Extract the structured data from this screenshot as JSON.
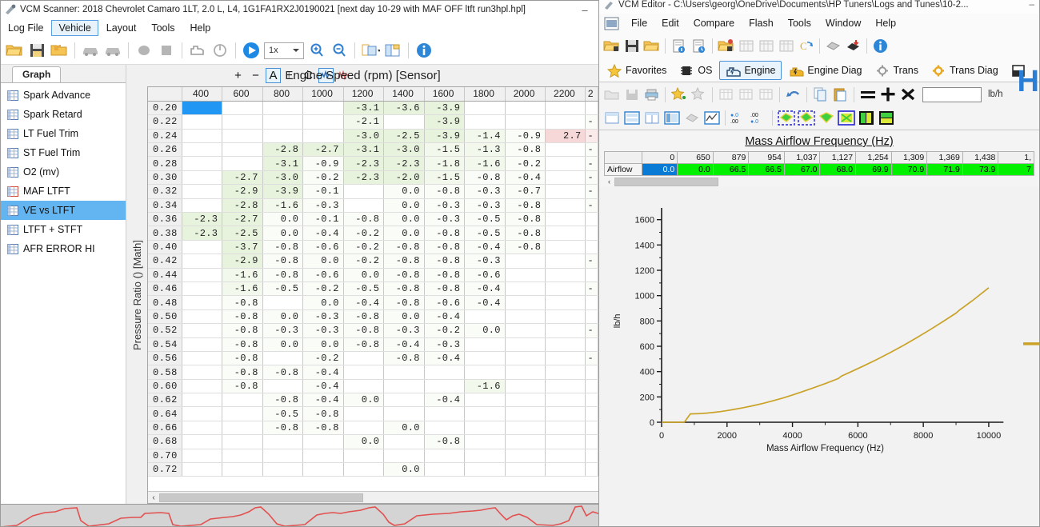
{
  "scanner": {
    "title": "VCM Scanner: 2018 Chevrolet Camaro 1LT, 2.0 L, L4, 1G1FA1RX2J0190021 [next day 10-29 with MAF OFF ltft run3hpl.hpl]",
    "minimize_label": "–",
    "menus": [
      {
        "label": "Log File",
        "active": false
      },
      {
        "label": "Vehicle",
        "active": true
      },
      {
        "label": "Layout",
        "active": false
      },
      {
        "label": "Tools",
        "active": false
      },
      {
        "label": "Help",
        "active": false
      }
    ],
    "toolbar": {
      "playback_speed": "1x",
      "icons": [
        "open-folder-icon",
        "save-icon",
        "open-recent-icon",
        "vehicle-icon",
        "vehicle-alt-icon",
        "record-icon",
        "stop-icon",
        "engine-icon",
        "power-icon",
        "play-icon",
        "zoom-in-icon",
        "zoom-out-icon",
        "layout-icon",
        "save-layout-icon",
        "info-icon"
      ]
    },
    "tab_label": "Graph",
    "sidebar_items": [
      {
        "label": "Spark Advance",
        "selected": false
      },
      {
        "label": "Spark Retard",
        "selected": false
      },
      {
        "label": "LT Fuel Trim",
        "selected": false
      },
      {
        "label": "ST Fuel Trim",
        "selected": false
      },
      {
        "label": "O2 (mv)",
        "selected": false
      },
      {
        "label": "MAF LTFT",
        "selected": false
      },
      {
        "label": "VE vs LTFT",
        "selected": true
      },
      {
        "label": "LTFT + STFT",
        "selected": false
      },
      {
        "label": "AFR ERROR HI",
        "selected": false
      }
    ],
    "grid_toolbar": {
      "plus": "+",
      "minus": "−",
      "a": "A",
      "l": "L",
      "c": "C",
      "graph1": "graph-icon",
      "graph2": "graph-alt-icon"
    },
    "grid": {
      "title": "Engine Speed (rpm) [Sensor]",
      "y_axis_label": "Pressure Ratio () [Math]",
      "corner": "",
      "columns": [
        "400",
        "600",
        "800",
        "1000",
        "1200",
        "1400",
        "1600",
        "1800",
        "2000",
        "2200",
        "2"
      ],
      "rows": [
        {
          "h": "0.20",
          "c": [
            "",
            "",
            "",
            "",
            "-3.1",
            "-3.6",
            "-3.9",
            "",
            "",
            "",
            ""
          ],
          "s": [
            "sel",
            "",
            "",
            "",
            "g1",
            "g1",
            "g1",
            "",
            "",
            "",
            ""
          ]
        },
        {
          "h": "0.22",
          "c": [
            "",
            "",
            "",
            "",
            "-2.1",
            "",
            "-3.9",
            "",
            "",
            "",
            "-"
          ],
          "s": [
            "",
            "",
            "",
            "",
            "g2",
            "",
            "g1",
            "",
            "",
            "",
            "g3"
          ]
        },
        {
          "h": "0.24",
          "c": [
            "",
            "",
            "",
            "",
            "-3.0",
            "-2.5",
            "-3.9",
            "-1.4",
            "-0.9",
            "2.7",
            "-"
          ],
          "s": [
            "",
            "",
            "",
            "",
            "g1",
            "g1",
            "g1",
            "g2",
            "g3",
            "r1",
            "r2"
          ]
        },
        {
          "h": "0.26",
          "c": [
            "",
            "",
            "-2.8",
            "-2.7",
            "-3.1",
            "-3.0",
            "-1.5",
            "-1.3",
            "-0.8",
            "",
            "-"
          ],
          "s": [
            "",
            "",
            "g1",
            "g1",
            "g1",
            "g1",
            "g2",
            "g2",
            "g3",
            "",
            "g3"
          ]
        },
        {
          "h": "0.28",
          "c": [
            "",
            "",
            "-3.1",
            "-0.9",
            "-2.3",
            "-2.3",
            "-1.8",
            "-1.6",
            "-0.2",
            "",
            "-"
          ],
          "s": [
            "",
            "",
            "g1",
            "g3",
            "g1",
            "g1",
            "g2",
            "g2",
            "g3",
            "",
            "g3"
          ]
        },
        {
          "h": "0.30",
          "c": [
            "",
            "-2.7",
            "-3.0",
            "-0.2",
            "-2.3",
            "-2.0",
            "-1.5",
            "-0.8",
            "-0.4",
            "",
            "-"
          ],
          "s": [
            "",
            "g1",
            "g1",
            "g3",
            "g1",
            "g1",
            "g2",
            "g3",
            "g3",
            "",
            "g3"
          ]
        },
        {
          "h": "0.32",
          "c": [
            "",
            "-2.9",
            "-3.9",
            "-0.1",
            "",
            "0.0",
            "-0.8",
            "-0.3",
            "-0.7",
            "",
            "-"
          ],
          "s": [
            "",
            "g1",
            "g1",
            "g3",
            "",
            "g3",
            "g3",
            "g3",
            "g3",
            "",
            "g3"
          ]
        },
        {
          "h": "0.34",
          "c": [
            "",
            "-2.8",
            "-1.6",
            "-0.3",
            "",
            "0.0",
            "-0.3",
            "-0.3",
            "-0.8",
            "",
            "-"
          ],
          "s": [
            "",
            "g1",
            "g2",
            "g3",
            "",
            "g3",
            "g3",
            "g3",
            "g3",
            "",
            "g3"
          ]
        },
        {
          "h": "0.36",
          "c": [
            "-2.3",
            "-2.7",
            "0.0",
            "-0.1",
            "-0.8",
            "0.0",
            "-0.3",
            "-0.5",
            "-0.8",
            "",
            ""
          ],
          "s": [
            "g1",
            "g1",
            "g3",
            "g3",
            "g3",
            "g3",
            "g3",
            "g3",
            "g3",
            "",
            ""
          ]
        },
        {
          "h": "0.38",
          "c": [
            "-2.3",
            "-2.5",
            "0.0",
            "-0.4",
            "-0.2",
            "0.0",
            "-0.8",
            "-0.5",
            "-0.8",
            "",
            ""
          ],
          "s": [
            "g1",
            "g1",
            "g3",
            "g3",
            "g3",
            "g3",
            "g3",
            "g3",
            "g3",
            "",
            ""
          ]
        },
        {
          "h": "0.40",
          "c": [
            "",
            "-3.7",
            "-0.8",
            "-0.6",
            "-0.2",
            "-0.8",
            "-0.8",
            "-0.4",
            "-0.8",
            "",
            ""
          ],
          "s": [
            "",
            "g1",
            "g3",
            "g3",
            "g3",
            "g3",
            "g3",
            "g3",
            "g3",
            "",
            ""
          ]
        },
        {
          "h": "0.42",
          "c": [
            "",
            "-2.9",
            "-0.8",
            "0.0",
            "-0.2",
            "-0.8",
            "-0.8",
            "-0.3",
            "",
            "",
            "-"
          ],
          "s": [
            "",
            "g1",
            "g3",
            "g3",
            "g3",
            "g3",
            "g3",
            "g3",
            "",
            "",
            "g3"
          ]
        },
        {
          "h": "0.44",
          "c": [
            "",
            "-1.6",
            "-0.8",
            "-0.6",
            "0.0",
            "-0.8",
            "-0.8",
            "-0.6",
            "",
            "",
            ""
          ],
          "s": [
            "",
            "g2",
            "g3",
            "g3",
            "g3",
            "g3",
            "g3",
            "g3",
            "",
            "",
            ""
          ]
        },
        {
          "h": "0.46",
          "c": [
            "",
            "-1.6",
            "-0.5",
            "-0.2",
            "-0.5",
            "-0.8",
            "-0.8",
            "-0.4",
            "",
            "",
            "-"
          ],
          "s": [
            "",
            "g2",
            "g3",
            "g3",
            "g3",
            "g3",
            "g3",
            "g3",
            "",
            "",
            "g3"
          ]
        },
        {
          "h": "0.48",
          "c": [
            "",
            "-0.8",
            "",
            "0.0",
            "-0.4",
            "-0.8",
            "-0.6",
            "-0.4",
            "",
            "",
            ""
          ],
          "s": [
            "",
            "g3",
            "",
            "g3",
            "g3",
            "g3",
            "g3",
            "g3",
            "",
            "",
            ""
          ]
        },
        {
          "h": "0.50",
          "c": [
            "",
            "-0.8",
            "0.0",
            "-0.3",
            "-0.8",
            "0.0",
            "-0.4",
            "",
            "",
            "",
            ""
          ],
          "s": [
            "",
            "g3",
            "g3",
            "g3",
            "g3",
            "g3",
            "g3",
            "",
            "",
            "",
            ""
          ]
        },
        {
          "h": "0.52",
          "c": [
            "",
            "-0.8",
            "-0.3",
            "-0.3",
            "-0.8",
            "-0.3",
            "-0.2",
            "0.0",
            "",
            "",
            "-"
          ],
          "s": [
            "",
            "g3",
            "g3",
            "g3",
            "g3",
            "g3",
            "g3",
            "g3",
            "",
            "",
            "g3"
          ]
        },
        {
          "h": "0.54",
          "c": [
            "",
            "-0.8",
            "0.0",
            "0.0",
            "-0.8",
            "-0.4",
            "-0.3",
            "",
            "",
            "",
            ""
          ],
          "s": [
            "",
            "g3",
            "g3",
            "g3",
            "g3",
            "g3",
            "g3",
            "",
            "",
            "",
            ""
          ]
        },
        {
          "h": "0.56",
          "c": [
            "",
            "-0.8",
            "",
            "-0.2",
            "",
            "-0.8",
            "-0.4",
            "",
            "",
            "",
            "-"
          ],
          "s": [
            "",
            "g3",
            "",
            "g3",
            "",
            "g3",
            "g3",
            "",
            "",
            "",
            "g3"
          ]
        },
        {
          "h": "0.58",
          "c": [
            "",
            "-0.8",
            "-0.8",
            "-0.4",
            "",
            "",
            "",
            "",
            "",
            "",
            ""
          ],
          "s": [
            "",
            "g3",
            "g3",
            "g3",
            "",
            "",
            "",
            "",
            "",
            "",
            ""
          ]
        },
        {
          "h": "0.60",
          "c": [
            "",
            "-0.8",
            "",
            "-0.4",
            "",
            "",
            "",
            "-1.6",
            "",
            "",
            ""
          ],
          "s": [
            "",
            "g3",
            "",
            "g3",
            "",
            "",
            "",
            "g2",
            "",
            "",
            ""
          ]
        },
        {
          "h": "0.62",
          "c": [
            "",
            "",
            "-0.8",
            "-0.4",
            "0.0",
            "",
            "-0.4",
            "",
            "",
            "",
            ""
          ],
          "s": [
            "",
            "",
            "g3",
            "g3",
            "g3",
            "",
            "g3",
            "",
            "",
            "",
            ""
          ]
        },
        {
          "h": "0.64",
          "c": [
            "",
            "",
            "-0.5",
            "-0.8",
            "",
            "",
            "",
            "",
            "",
            "",
            ""
          ],
          "s": [
            "",
            "",
            "g3",
            "g3",
            "",
            "",
            "",
            "",
            "",
            "",
            ""
          ]
        },
        {
          "h": "0.66",
          "c": [
            "",
            "",
            "-0.8",
            "-0.8",
            "",
            "0.0",
            "",
            "",
            "",
            "",
            ""
          ],
          "s": [
            "",
            "",
            "g3",
            "g3",
            "",
            "g3",
            "",
            "",
            "",
            "",
            ""
          ]
        },
        {
          "h": "0.68",
          "c": [
            "",
            "",
            "",
            "",
            "0.0",
            "",
            "-0.8",
            "",
            "",
            "",
            ""
          ],
          "s": [
            "",
            "",
            "",
            "",
            "g3",
            "",
            "g3",
            "",
            "",
            "",
            ""
          ]
        },
        {
          "h": "0.70",
          "c": [
            "",
            "",
            "",
            "",
            "",
            "",
            "",
            "",
            "",
            "",
            ""
          ],
          "s": [
            "",
            "",
            "",
            "",
            "",
            "",
            "",
            "",
            "",
            "",
            ""
          ]
        },
        {
          "h": "0.72",
          "c": [
            "",
            "",
            "",
            "",
            "",
            "0.0",
            "",
            "",
            "",
            "",
            ""
          ],
          "s": [
            "",
            "",
            "",
            "",
            "",
            "g3",
            "",
            "",
            "",
            "",
            ""
          ]
        }
      ]
    },
    "hscroll_arrow": "‹"
  },
  "editor": {
    "title": "VCM Editor - C:\\Users\\georg\\OneDrive\\Documents\\HP Tuners\\Logs and Tunes\\10-2...",
    "minimize_label": "–",
    "menus": [
      "File",
      "Edit",
      "Compare",
      "Flash",
      "Tools",
      "Window",
      "Help"
    ],
    "toolbar1_icons": [
      "open-icon",
      "save-icon",
      "open-folder-icon",
      "file-info-icon",
      "file-history-icon",
      "new-tune-icon",
      "table-icon-1",
      "table-icon-2",
      "table-icon-3",
      "compare-icon",
      "flash-read-icon",
      "flash-write-icon",
      "info-icon"
    ],
    "tabs": [
      {
        "label": "Favorites",
        "icon": "star-icon",
        "active": false
      },
      {
        "label": "OS",
        "icon": "chip-icon",
        "active": false
      },
      {
        "label": "Engine",
        "icon": "engine-icon",
        "active": true
      },
      {
        "label": "Engine Diag",
        "icon": "engine-diag-icon",
        "active": false
      },
      {
        "label": "Trans",
        "icon": "gear-icon",
        "active": false
      },
      {
        "label": "Trans Diag",
        "icon": "gear-diag-icon",
        "active": false
      }
    ],
    "toolbar2": {
      "icons": [
        "open-icon",
        "save-icon",
        "print-icon",
        "add-favorite-icon",
        "remove-favorite-icon",
        "table-icon-1",
        "table-icon-2",
        "table-icon-3",
        "undo-icon",
        "copy-icon",
        "paste-icon",
        "equals-icon",
        "plus-icon",
        "multiply-icon"
      ],
      "value_input": "",
      "unit": "lb/h"
    },
    "toolbar3_icons": [
      "view-single-icon",
      "view-split-h-icon",
      "view-split-v-icon",
      "view-table-icon",
      "diamond-icon",
      "graph-icon",
      "decimals-down-icon",
      "decimals-up-icon",
      "interp-left-icon",
      "interp-right-icon",
      "interp-both-icon",
      "interp-all-icon",
      "interp-vert-icon",
      "interp-horiz-icon"
    ],
    "maf_table": {
      "title": "Mass Airflow Frequency (Hz)",
      "row_label": "Airflow",
      "columns": [
        "0",
        "650",
        "879",
        "954",
        "1,037",
        "1,127",
        "1,254",
        "1,309",
        "1,369",
        "1,438",
        "1,"
      ],
      "values": [
        "0.0",
        "0.0",
        "66.5",
        "66.5",
        "67.0",
        "68.0",
        "69.9",
        "70.9",
        "71.9",
        "73.9",
        "7"
      ],
      "selected_index": 0,
      "scroll_arrow": "‹"
    },
    "chart": {
      "accent_color": "#c9a227"
    },
    "logo": "H"
  },
  "chart_data": {
    "type": "line",
    "title": "",
    "xlabel": "Mass Airflow Frequency (Hz)",
    "ylabel": "lb/h",
    "xlim": [
      0,
      11200
    ],
    "ylim": [
      0,
      1680
    ],
    "xticks": [
      0,
      2000,
      4000,
      6000,
      8000,
      10000
    ],
    "yticks": [
      0,
      200,
      400,
      600,
      800,
      1000,
      1200,
      1400,
      1600
    ],
    "grid": false,
    "legend": "none",
    "series": [
      {
        "name": "Airflow",
        "color": "#c9a227",
        "x": [
          0,
          650,
          700,
          879,
          954,
          1037,
          1127,
          1254,
          1309,
          1369,
          1438,
          1600,
          1800,
          2000,
          2200,
          2500,
          2800,
          3100,
          3400,
          3700,
          4000,
          4300,
          4600,
          5000,
          5400,
          5500,
          5800,
          6200,
          6600,
          7000,
          7400,
          7800,
          8200,
          8600,
          9000,
          9100,
          9500,
          10000
        ],
        "y": [
          0,
          0,
          2,
          66.5,
          66.5,
          67,
          68,
          69.9,
          70.9,
          71.9,
          73.9,
          78,
          84,
          92,
          101,
          115,
          131,
          149,
          169,
          191,
          215,
          241,
          268,
          305,
          345,
          365,
          400,
          448,
          498,
          552,
          608,
          668,
          730,
          795,
          862,
          885,
          960,
          1062
        ]
      }
    ]
  }
}
